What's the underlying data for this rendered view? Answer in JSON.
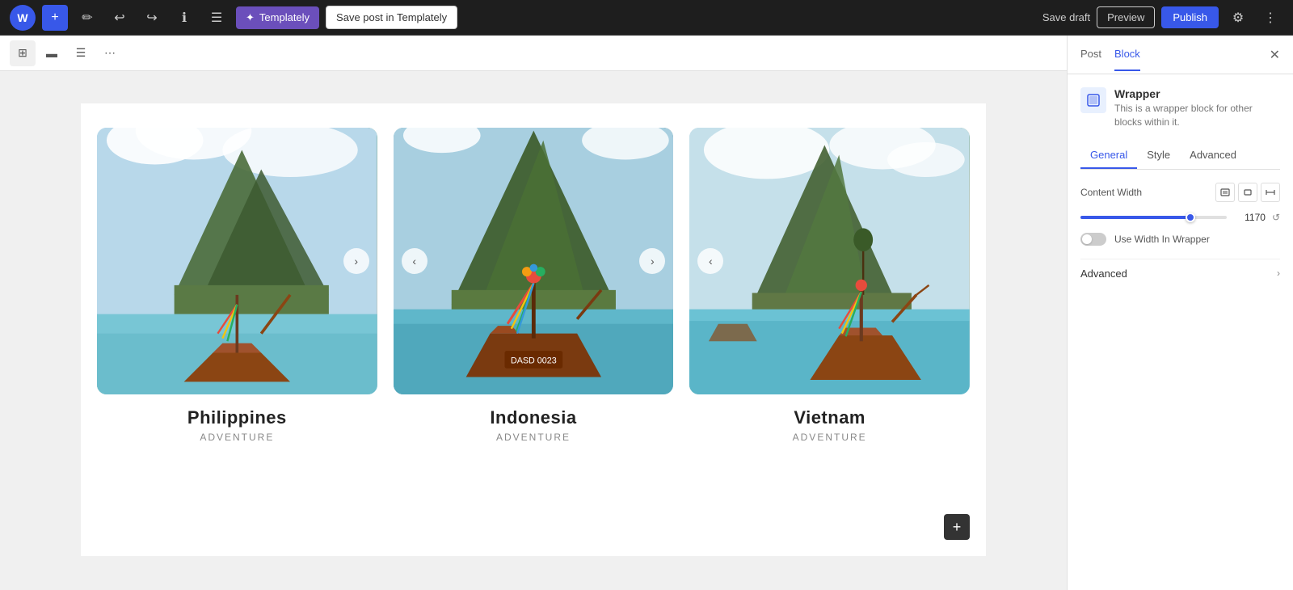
{
  "topbar": {
    "wp_logo": "W",
    "add_btn": "+",
    "edit_btn": "✏",
    "undo_btn": "↩",
    "redo_btn": "↪",
    "info_btn": "ℹ",
    "list_btn": "☰",
    "templately_label": "Templately",
    "save_templately_label": "Save post in Templately",
    "save_draft_label": "Save draft",
    "preview_label": "Preview",
    "publish_label": "Publish",
    "settings_icon": "⚙"
  },
  "block_toolbar": {
    "icon_1": "⊞",
    "icon_2": "▬",
    "icon_3": "☰",
    "icon_4": "⋯"
  },
  "cards": [
    {
      "title": "Philippines",
      "subtitle": "ADVENTURE",
      "has_left_nav": false,
      "has_right_nav": true,
      "img_class": "img-ph-1"
    },
    {
      "title": "Indonesia",
      "subtitle": "ADVENTURE",
      "has_left_nav": true,
      "has_right_nav": true,
      "img_class": "img-ph-2"
    },
    {
      "title": "Vietnam",
      "subtitle": "ADVENTURE",
      "has_left_nav": true,
      "has_right_nav": false,
      "img_class": "img-ph-3"
    }
  ],
  "sidebar": {
    "tab_post": "Post",
    "tab_block": "Block",
    "close_btn": "✕",
    "block_name": "Wrapper",
    "block_desc": "This is a wrapper block for other blocks within it.",
    "sub_tab_general": "General",
    "sub_tab_style": "Style",
    "sub_tab_advanced": "Advanced",
    "content_width_label": "Content Width",
    "content_width_value": "1170",
    "slider_value": "1170",
    "use_width_label": "Use Width In Wrapper",
    "accordion_advanced": "Advanced",
    "accordion_arrow": "›"
  }
}
